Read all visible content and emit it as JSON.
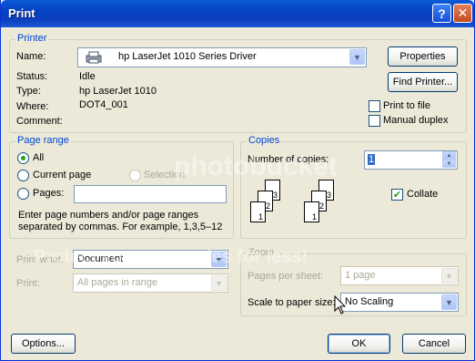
{
  "window": {
    "title": "Print"
  },
  "titlebar": {
    "help_glyph": "?",
    "close_glyph": "✕"
  },
  "printer": {
    "group_label": "Printer",
    "name_label": "Name:",
    "name_value": "hp LaserJet 1010 Series Driver",
    "status_label": "Status:",
    "status_value": "Idle",
    "type_label": "Type:",
    "type_value": "hp LaserJet 1010",
    "where_label": "Where:",
    "where_value": "DOT4_001",
    "comment_label": "Comment:",
    "properties_label": "Properties",
    "find_printer_label": "Find Printer...",
    "print_to_file_label": "Print to file",
    "manual_duplex_label": "Manual duplex"
  },
  "page_range": {
    "group_label": "Page range",
    "all_label": "All",
    "current_page_label": "Current page",
    "selection_label": "Selection",
    "pages_label": "Pages:",
    "pages_value": "",
    "help_text_1": "Enter page numbers and/or page ranges",
    "help_text_2": "separated by commas.  For example, 1,3,5–12"
  },
  "copies": {
    "group_label": "Copies",
    "number_label": "Number of copies:",
    "number_value": "1",
    "collate_label": "Collate",
    "collate_checked": true,
    "page_numbers": [
      "1",
      "2",
      "3"
    ]
  },
  "print_what": {
    "label": "Print what:",
    "value": "Document",
    "print_label": "Print:",
    "print_value": "All pages in range"
  },
  "zoom": {
    "group_label": "Zoom",
    "pages_per_sheet_label": "Pages per sheet:",
    "pages_per_sheet_value": "1 page",
    "scale_label": "Scale to paper size:",
    "scale_value": "No Scaling"
  },
  "footer": {
    "options_label": "Options...",
    "ok_label": "OK",
    "cancel_label": "Cancel"
  },
  "watermark": {
    "text_1": "photobucket",
    "text_2": "Protect your memories for less!"
  }
}
